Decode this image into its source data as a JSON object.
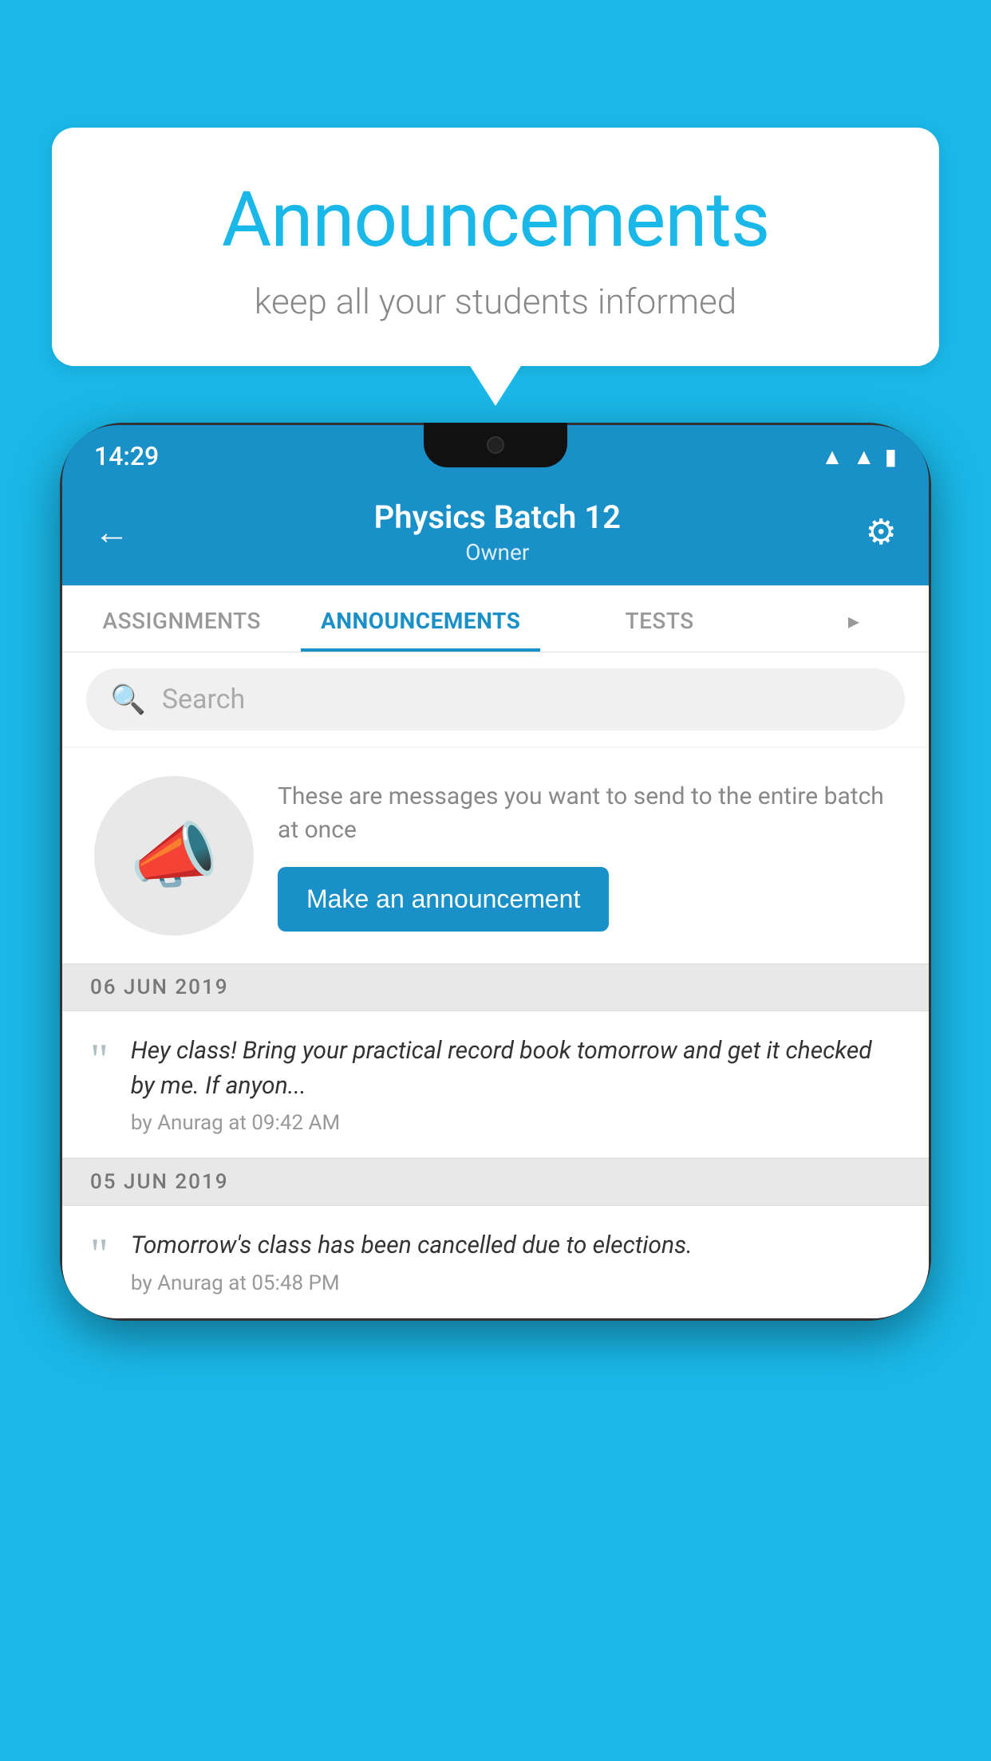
{
  "background_color": "#1ab8e8",
  "speech_bubble": {
    "title": "Announcements",
    "subtitle": "keep all your students informed"
  },
  "phone": {
    "status_bar": {
      "time": "14:29",
      "icons": [
        "wifi",
        "signal",
        "battery"
      ]
    },
    "header": {
      "back_label": "←",
      "title": "Physics Batch 12",
      "subtitle": "Owner",
      "gear_label": "⚙"
    },
    "tabs": [
      {
        "label": "ASSIGNMENTS",
        "active": false
      },
      {
        "label": "ANNOUNCEMENTS",
        "active": true
      },
      {
        "label": "TESTS",
        "active": false
      },
      {
        "label": "...",
        "active": false,
        "partial": true
      }
    ],
    "search": {
      "placeholder": "Search"
    },
    "promo": {
      "description": "These are messages you want to send to the entire batch at once",
      "button_label": "Make an announcement"
    },
    "announcements": [
      {
        "date": "06  JUN  2019",
        "message": "Hey class! Bring your practical record book tomorrow and get it checked by me. If anyon...",
        "meta": "by Anurag at 09:42 AM"
      },
      {
        "date": "05  JUN  2019",
        "message": "Tomorrow's class has been cancelled due to elections.",
        "meta": "by Anurag at 05:48 PM"
      }
    ]
  }
}
